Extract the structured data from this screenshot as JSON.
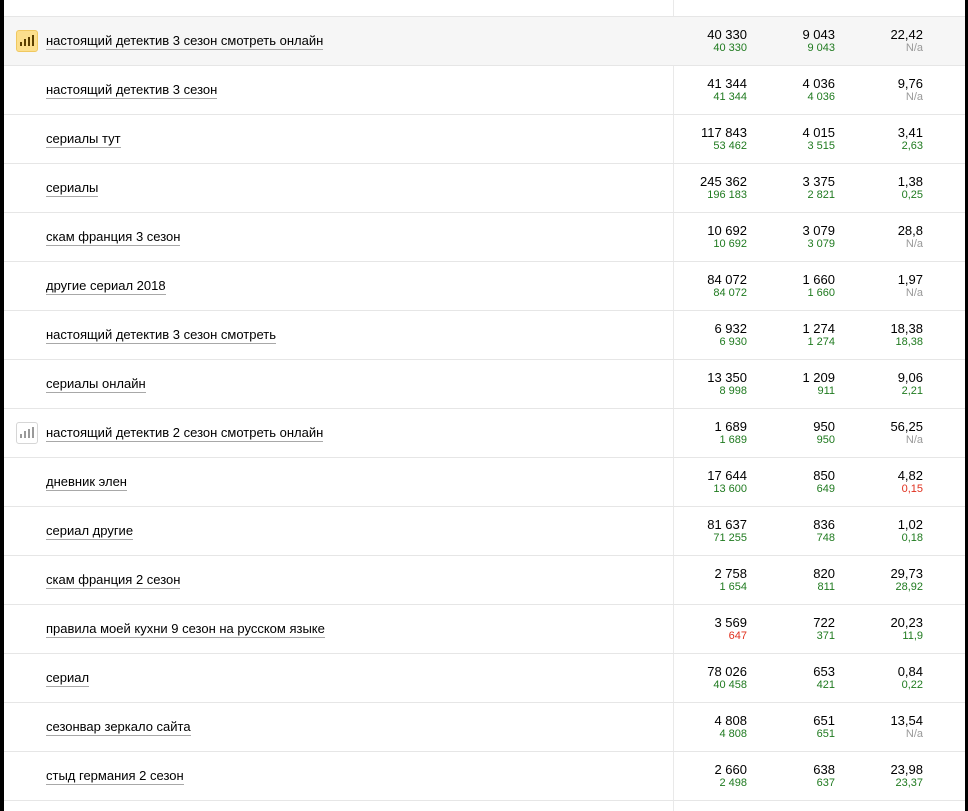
{
  "colors": {
    "sub_positive": "#1f7a1f",
    "sub_na": "#999999",
    "sub_negative": "#e0301e",
    "chart_active": "#fcdf8d"
  },
  "rows": [
    {
      "phrase": "настоящий детектив 3 сезон смотреть онлайн",
      "chart_icon": "active",
      "c1": {
        "main": "40 330",
        "sub": "40 330"
      },
      "c2": {
        "main": "9 043",
        "sub": "9 043"
      },
      "c3": {
        "main": "22,42",
        "sub": "N/a",
        "sub_style": "na"
      }
    },
    {
      "phrase": "настоящий детектив 3 сезон",
      "chart_icon": "none",
      "c1": {
        "main": "41 344",
        "sub": "41 344"
      },
      "c2": {
        "main": "4 036",
        "sub": "4 036"
      },
      "c3": {
        "main": "9,76",
        "sub": "N/a",
        "sub_style": "na"
      }
    },
    {
      "phrase": "сериалы тут",
      "chart_icon": "none",
      "c1": {
        "main": "117 843",
        "sub": "53 462"
      },
      "c2": {
        "main": "4 015",
        "sub": "3 515"
      },
      "c3": {
        "main": "3,41",
        "sub": "2,63"
      }
    },
    {
      "phrase": "сериалы",
      "chart_icon": "none",
      "c1": {
        "main": "245 362",
        "sub": "196 183"
      },
      "c2": {
        "main": "3 375",
        "sub": "2 821"
      },
      "c3": {
        "main": "1,38",
        "sub": "0,25"
      }
    },
    {
      "phrase": "скам франция 3 сезон",
      "chart_icon": "none",
      "c1": {
        "main": "10 692",
        "sub": "10 692"
      },
      "c2": {
        "main": "3 079",
        "sub": "3 079"
      },
      "c3": {
        "main": "28,8",
        "sub": "N/a",
        "sub_style": "na"
      }
    },
    {
      "phrase": "другие сериал 2018",
      "chart_icon": "none",
      "c1": {
        "main": "84 072",
        "sub": "84 072"
      },
      "c2": {
        "main": "1 660",
        "sub": "1 660"
      },
      "c3": {
        "main": "1,97",
        "sub": "N/a",
        "sub_style": "na"
      }
    },
    {
      "phrase": "настоящий детектив 3 сезон смотреть",
      "chart_icon": "none",
      "c1": {
        "main": "6 932",
        "sub": "6 930"
      },
      "c2": {
        "main": "1 274",
        "sub": "1 274"
      },
      "c3": {
        "main": "18,38",
        "sub": "18,38"
      }
    },
    {
      "phrase": "сериалы онлайн",
      "chart_icon": "none",
      "c1": {
        "main": "13 350",
        "sub": "8 998"
      },
      "c2": {
        "main": "1 209",
        "sub": "911"
      },
      "c3": {
        "main": "9,06",
        "sub": "2,21"
      }
    },
    {
      "phrase": "настоящий детектив 2 сезон смотреть онлайн",
      "chart_icon": "inactive",
      "c1": {
        "main": "1 689",
        "sub": "1 689"
      },
      "c2": {
        "main": "950",
        "sub": "950"
      },
      "c3": {
        "main": "56,25",
        "sub": "N/a",
        "sub_style": "na"
      }
    },
    {
      "phrase": "дневник элен",
      "chart_icon": "none",
      "c1": {
        "main": "17 644",
        "sub": "13 600"
      },
      "c2": {
        "main": "850",
        "sub": "649"
      },
      "c3": {
        "main": "4,82",
        "sub": "0,15",
        "sub_style": "red"
      }
    },
    {
      "phrase": "сериал другие",
      "chart_icon": "none",
      "c1": {
        "main": "81 637",
        "sub": "71 255"
      },
      "c2": {
        "main": "836",
        "sub": "748"
      },
      "c3": {
        "main": "1,02",
        "sub": "0,18"
      }
    },
    {
      "phrase": "скам франция 2 сезон",
      "chart_icon": "none",
      "c1": {
        "main": "2 758",
        "sub": "1 654"
      },
      "c2": {
        "main": "820",
        "sub": "811"
      },
      "c3": {
        "main": "29,73",
        "sub": "28,92"
      }
    },
    {
      "phrase": "правила моей кухни 9 сезон на русском языке",
      "chart_icon": "none",
      "c1": {
        "main": "3 569",
        "sub": "647",
        "sub_style": "red"
      },
      "c2": {
        "main": "722",
        "sub": "371"
      },
      "c3": {
        "main": "20,23",
        "sub": "11,9"
      }
    },
    {
      "phrase": "сериал",
      "chart_icon": "none",
      "c1": {
        "main": "78 026",
        "sub": "40 458"
      },
      "c2": {
        "main": "653",
        "sub": "421"
      },
      "c3": {
        "main": "0,84",
        "sub": "0,22"
      }
    },
    {
      "phrase": "сезонвар зеркало сайта",
      "chart_icon": "none",
      "c1": {
        "main": "4 808",
        "sub": "4 808"
      },
      "c2": {
        "main": "651",
        "sub": "651"
      },
      "c3": {
        "main": "13,54",
        "sub": "N/a",
        "sub_style": "na"
      }
    },
    {
      "phrase": "стыд германия 2 сезон",
      "chart_icon": "none",
      "c1": {
        "main": "2 660",
        "sub": "2 498"
      },
      "c2": {
        "main": "638",
        "sub": "637"
      },
      "c3": {
        "main": "23,98",
        "sub": "23,37"
      }
    }
  ]
}
